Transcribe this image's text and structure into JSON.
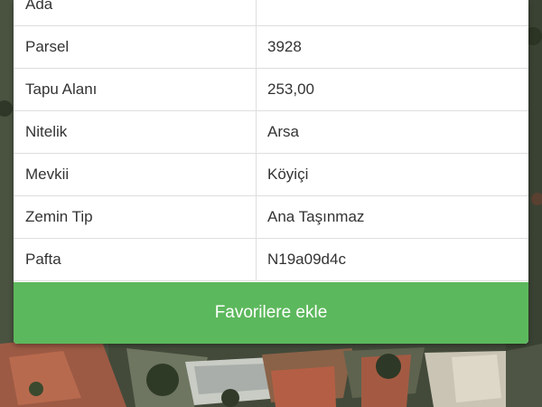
{
  "parcel_info": {
    "rows": [
      {
        "label": "Ada",
        "value": ""
      },
      {
        "label": "Parsel",
        "value": "3928"
      },
      {
        "label": "Tapu Alanı",
        "value": "253,00"
      },
      {
        "label": "Nitelik",
        "value": "Arsa"
      },
      {
        "label": "Mevkii",
        "value": "Köyiçi"
      },
      {
        "label": "Zemin Tip",
        "value": "Ana Taşınmaz"
      },
      {
        "label": "Pafta",
        "value": "N19a09d4c"
      }
    ]
  },
  "actions": {
    "favorite_label": "Favorilere ekle"
  },
  "colors": {
    "button_green": "#5cb85c",
    "card_bg": "#ffffff",
    "text": "#333333",
    "divider": "#dedede"
  }
}
